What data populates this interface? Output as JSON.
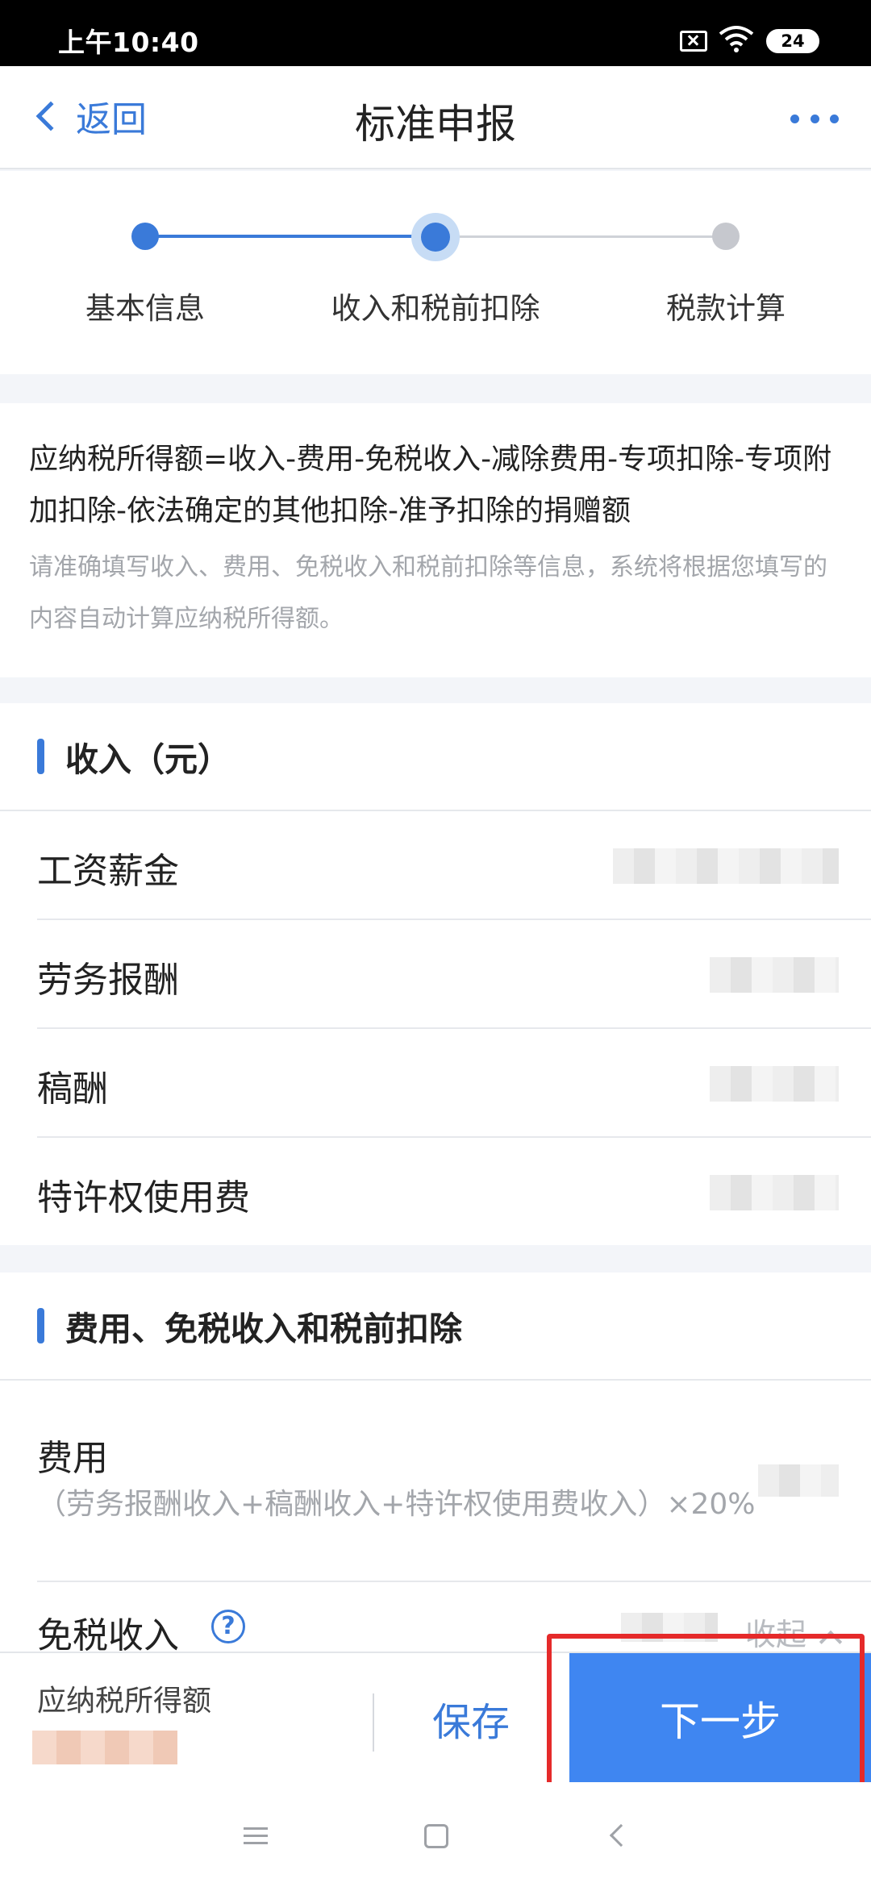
{
  "status_bar": {
    "time": "上午10:40",
    "battery": "24"
  },
  "nav": {
    "back_label": "返回",
    "title": "标准申报"
  },
  "stepper": {
    "steps": [
      {
        "label": "基本信息",
        "state": "done"
      },
      {
        "label": "收入和税前扣除",
        "state": "current"
      },
      {
        "label": "税款计算",
        "state": "pending"
      }
    ]
  },
  "formula": {
    "text": "应纳税所得额=收入-费用-免税收入-减除费用-专项扣除-专项附加扣除-依法确定的其他扣除-准予扣除的捐赠额",
    "hint": "请准确填写收入、费用、免税收入和税前扣除等信息，系统将根据您填写的内容自动计算应纳税所得额。"
  },
  "income": {
    "title": "收入（元）",
    "rows": [
      {
        "label": "工资薪金"
      },
      {
        "label": "劳务报酬"
      },
      {
        "label": "稿酬"
      },
      {
        "label": "特许权使用费"
      }
    ]
  },
  "deductions": {
    "title": "费用、免税收入和税前扣除",
    "expense_label": "费用",
    "expense_desc": "（劳务报酬收入+稿酬收入+特许权使用费收入）×20%",
    "taxfree_label": "免税收入",
    "help_glyph": "?",
    "collapse_label": "收起"
  },
  "bottom_bar": {
    "taxable_label": "应纳税所得额",
    "save_label": "保存",
    "next_label": "下一步"
  },
  "colors": {
    "accent": "#3a7ad9",
    "primary_button": "#3f86f1",
    "highlight": "#e52a2a"
  }
}
